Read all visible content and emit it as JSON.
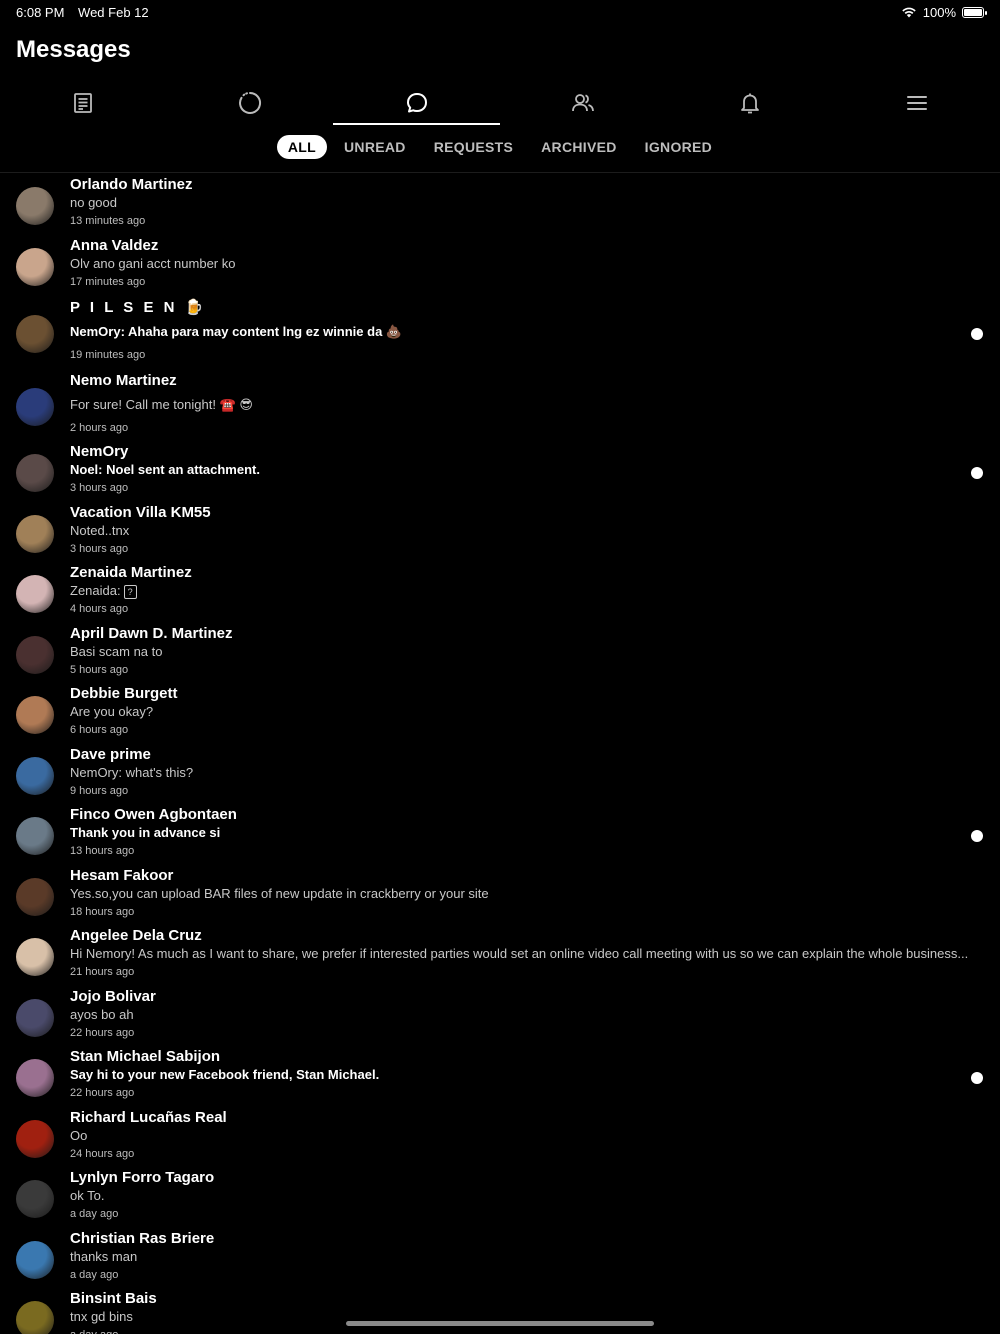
{
  "status_bar": {
    "time": "6:08 PM",
    "date": "Wed Feb 12",
    "battery": "100%"
  },
  "page_title": "Messages",
  "nav_icons": [
    "feed-icon",
    "stories-icon",
    "chat-bubble-icon",
    "friends-icon",
    "bell-icon",
    "menu-icon"
  ],
  "filter_tabs": [
    "ALL",
    "UNREAD",
    "REQUESTS",
    "ARCHIVED",
    "IGNORED"
  ],
  "conversations": [
    {
      "name": "Orlando Martinez",
      "preview": "no good",
      "time": "13 minutes ago",
      "unread": false,
      "avatar_color": "#8a7a6a"
    },
    {
      "name": "Anna Valdez",
      "preview": "Olv ano gani acct number ko",
      "time": "17 minutes ago",
      "unread": false,
      "avatar_color": "#c9a58c"
    },
    {
      "name": "P I L S E N 🍺",
      "preview": "NemOry: Ahaha para may content lng ez winnie da 💩",
      "time": "19 minutes ago",
      "unread": true,
      "avatar_color": "#6b5032"
    },
    {
      "name": "Nemo Martinez",
      "preview": "For sure! Call me tonight! ☎️ 😎",
      "time": "2 hours ago",
      "unread": false,
      "avatar_color": "#2a3c7a"
    },
    {
      "name": "NemOry",
      "preview": "Noel: Noel sent an attachment.",
      "time": "3 hours ago",
      "unread": true,
      "avatar_color": "#5a4a48"
    },
    {
      "name": "Vacation Villa KM55",
      "preview": "Noted..tnx",
      "time": "3 hours ago",
      "unread": false,
      "avatar_color": "#a08058"
    },
    {
      "name": "Zenaida Martinez",
      "preview": "Zenaida:",
      "time": "4 hours ago",
      "unread": false,
      "avatar_color": "#d3b4b4"
    },
    {
      "name": "April Dawn D. Martinez",
      "preview": "Basi scam na to",
      "time": "5 hours ago",
      "unread": false,
      "avatar_color": "#4a3030"
    },
    {
      "name": "Debbie Burgett",
      "preview": "Are you okay?",
      "time": "6 hours ago",
      "unread": false,
      "avatar_color": "#b07a55"
    },
    {
      "name": "Dave prime",
      "preview": "NemOry: what's this?",
      "time": "9 hours ago",
      "unread": false,
      "avatar_color": "#3a6aa0"
    },
    {
      "name": "Finco Owen Agbontaen",
      "preview": "Thank you in advance si",
      "time": "13 hours ago",
      "unread": true,
      "avatar_color": "#6a7a88"
    },
    {
      "name": "Hesam Fakoor",
      "preview": "Yes.so,you can upload BAR files of new update in crackberry or your site",
      "time": "18 hours ago",
      "unread": false,
      "avatar_color": "#5a3a28"
    },
    {
      "name": "Angelee Dela Cruz",
      "preview": "Hi Nemory! As much as I want to share, we prefer if interested parties would set an online video call meeting with us so we can explain the whole business...",
      "time": "21 hours ago",
      "unread": false,
      "avatar_color": "#d8c0a8"
    },
    {
      "name": "Jojo Bolivar",
      "preview": "ayos bo ah",
      "time": "22 hours ago",
      "unread": false,
      "avatar_color": "#4a4a6a"
    },
    {
      "name": "Stan Michael Sabijon",
      "preview": "Say hi to your new Facebook friend, Stan Michael.",
      "time": "22 hours ago",
      "unread": true,
      "avatar_color": "#9a7090"
    },
    {
      "name": "Richard Lucañas Real",
      "preview": "Oo",
      "time": "24 hours ago",
      "unread": false,
      "avatar_color": "#a02010"
    },
    {
      "name": "Lynlyn Forro Tagaro",
      "preview": "ok To.",
      "time": "a day ago",
      "unread": false,
      "avatar_color": "#3a3a3a"
    },
    {
      "name": "Christian Ras Briere",
      "preview": "thanks man",
      "time": "a day ago",
      "unread": false,
      "avatar_color": "#3a78b0"
    },
    {
      "name": "Binsint Bais",
      "preview": "tnx gd bins",
      "time": "a day ago",
      "unread": false,
      "avatar_color": "#7a6a20"
    }
  ]
}
